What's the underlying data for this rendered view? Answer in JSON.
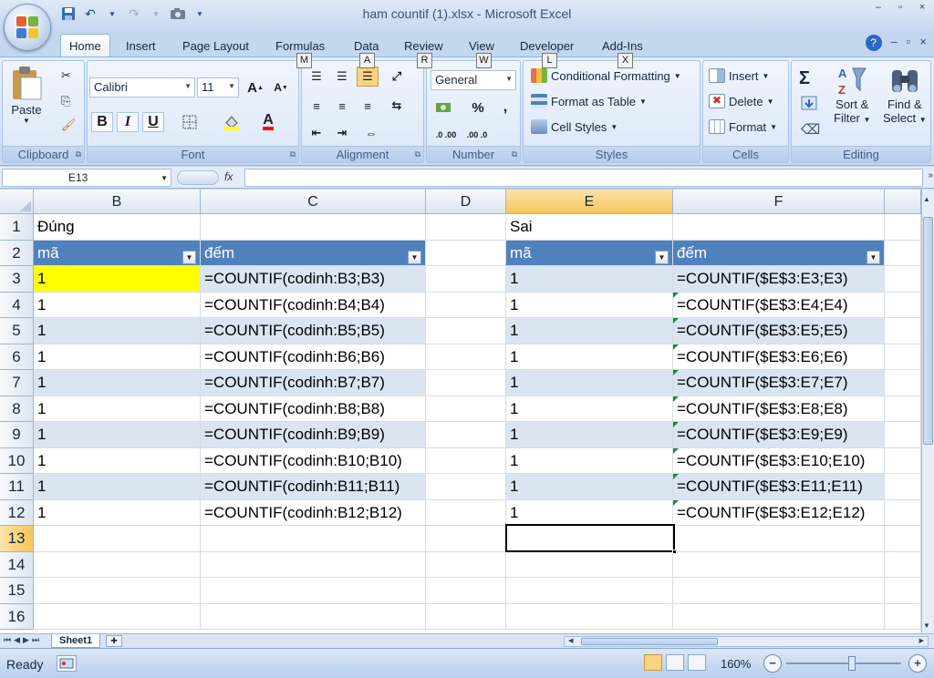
{
  "window": {
    "title": "ham countif (1).xlsx - Microsoft Excel"
  },
  "tabs": [
    "Home",
    "Insert",
    "Page Layout",
    "Formulas",
    "Data",
    "Review",
    "View",
    "Developer",
    "Add-Ins"
  ],
  "keytips": {
    "formulas": "M",
    "data": "A",
    "review": "R",
    "view": "W",
    "developer": "L",
    "addins": "X"
  },
  "ribbon": {
    "clipboard": {
      "paste": "Paste",
      "label": "Clipboard"
    },
    "font": {
      "name": "Calibri",
      "size": "11",
      "label": "Font",
      "bold": "B",
      "italic": "I",
      "underline": "U"
    },
    "alignment": {
      "label": "Alignment"
    },
    "number": {
      "format": "General",
      "label": "Number",
      "percent": "%",
      "comma": ",",
      "inc_decimal": ".0 .00",
      "dec_decimal": ".00 .0"
    },
    "styles": {
      "conditional": "Conditional Formatting",
      "format_table": "Format as Table",
      "cell_styles": "Cell Styles",
      "label": "Styles"
    },
    "cells": {
      "insert": "Insert",
      "delete": "Delete",
      "format": "Format",
      "label": "Cells"
    },
    "editing": {
      "sum": "Σ",
      "sort": "Sort &",
      "sort2": "Filter",
      "find": "Find &",
      "find2": "Select",
      "label": "Editing"
    }
  },
  "formula_bar": {
    "name_box": "E13",
    "fx": "fx",
    "value": ""
  },
  "columns": [
    "B",
    "C",
    "D",
    "E",
    "F"
  ],
  "rows": [
    "1",
    "2",
    "3",
    "4",
    "5",
    "6",
    "7",
    "8",
    "9",
    "10",
    "11",
    "12",
    "13",
    "14",
    "15",
    "16"
  ],
  "sheet": {
    "b1": "Đúng",
    "e1": "Sai",
    "left_headers": [
      "mã",
      "đếm"
    ],
    "right_headers": [
      "mã",
      "đếm"
    ],
    "left_rows": [
      [
        "1",
        "=COUNTIF(codinh:B3;B3)"
      ],
      [
        "1",
        "=COUNTIF(codinh:B4;B4)"
      ],
      [
        "1",
        "=COUNTIF(codinh:B5;B5)"
      ],
      [
        "1",
        "=COUNTIF(codinh:B6;B6)"
      ],
      [
        "1",
        "=COUNTIF(codinh:B7;B7)"
      ],
      [
        "1",
        "=COUNTIF(codinh:B8;B8)"
      ],
      [
        "1",
        "=COUNTIF(codinh:B9;B9)"
      ],
      [
        "1",
        "=COUNTIF(codinh:B10;B10)"
      ],
      [
        "1",
        "=COUNTIF(codinh:B11;B11)"
      ],
      [
        "1",
        "=COUNTIF(codinh:B12;B12)"
      ]
    ],
    "right_rows": [
      [
        "1",
        "=COUNTIF($E$3:E3;E3)"
      ],
      [
        "1",
        "=COUNTIF($E$3:E4;E4)"
      ],
      [
        "1",
        "=COUNTIF($E$3:E5;E5)"
      ],
      [
        "1",
        "=COUNTIF($E$3:E6;E6)"
      ],
      [
        "1",
        "=COUNTIF($E$3:E7;E7)"
      ],
      [
        "1",
        "=COUNTIF($E$3:E8;E8)"
      ],
      [
        "1",
        "=COUNTIF($E$3:E9;E9)"
      ],
      [
        "1",
        "=COUNTIF($E$3:E10;E10)"
      ],
      [
        "1",
        "=COUNTIF($E$3:E11;E11)"
      ],
      [
        "1",
        "=COUNTIF($E$3:E12;E12)"
      ]
    ],
    "active_cell": "E13",
    "highlight_color": "#ffff00",
    "header_color": "#4f81bd",
    "band_color": "#dbe5f1"
  },
  "sheet_tabs": [
    "Sheet1"
  ],
  "status": {
    "text": "Ready",
    "zoom": "160%"
  }
}
